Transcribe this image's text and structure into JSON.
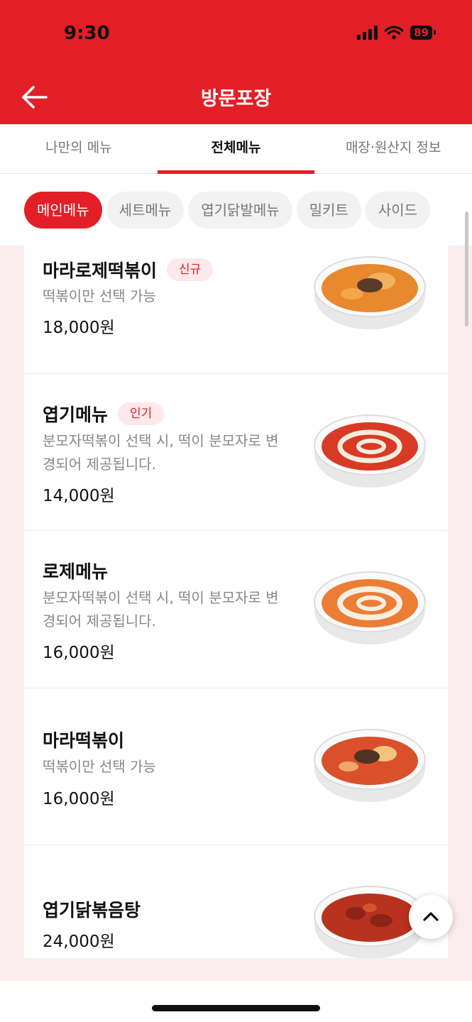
{
  "status_bar": {
    "time": "9:30",
    "battery": "89"
  },
  "header": {
    "title": "방문포장"
  },
  "tabs": [
    {
      "label": "나만의 메뉴"
    },
    {
      "label": "전체메뉴"
    },
    {
      "label": "매장·원산지 정보"
    }
  ],
  "categories": [
    {
      "label": "메인메뉴"
    },
    {
      "label": "세트메뉴"
    },
    {
      "label": "엽기닭발메뉴"
    },
    {
      "label": "밀키트"
    },
    {
      "label": "사이드"
    }
  ],
  "menu_items": [
    {
      "name": "마라로제떡볶이",
      "badge": "신규",
      "desc": "떡볶이만 선택 가능",
      "price": "18,000원"
    },
    {
      "name": "엽기메뉴",
      "badge": "인기",
      "desc": "분모자떡볶이 선택 시, 떡이 분모자로 변경되어 제공됩니다.",
      "price": "14,000원"
    },
    {
      "name": "로제메뉴",
      "desc": "분모자떡볶이 선택 시, 떡이 분모자로 변경되어 제공됩니다.",
      "price": "16,000원"
    },
    {
      "name": "마라떡볶이",
      "desc": "떡볶이만 선택 가능",
      "price": "16,000원"
    },
    {
      "name": "엽기닭볶음탕",
      "price": "24,000원"
    }
  ],
  "colors": {
    "brand": "#e21f26",
    "badge_bg": "#fde8ea",
    "list_bg": "#fbeced"
  },
  "icons": {
    "back": "arrow-left-icon",
    "scroll_top": "chevron-up-icon",
    "signal": "cellular-signal-icon",
    "wifi": "wifi-icon",
    "battery": "battery-icon"
  }
}
